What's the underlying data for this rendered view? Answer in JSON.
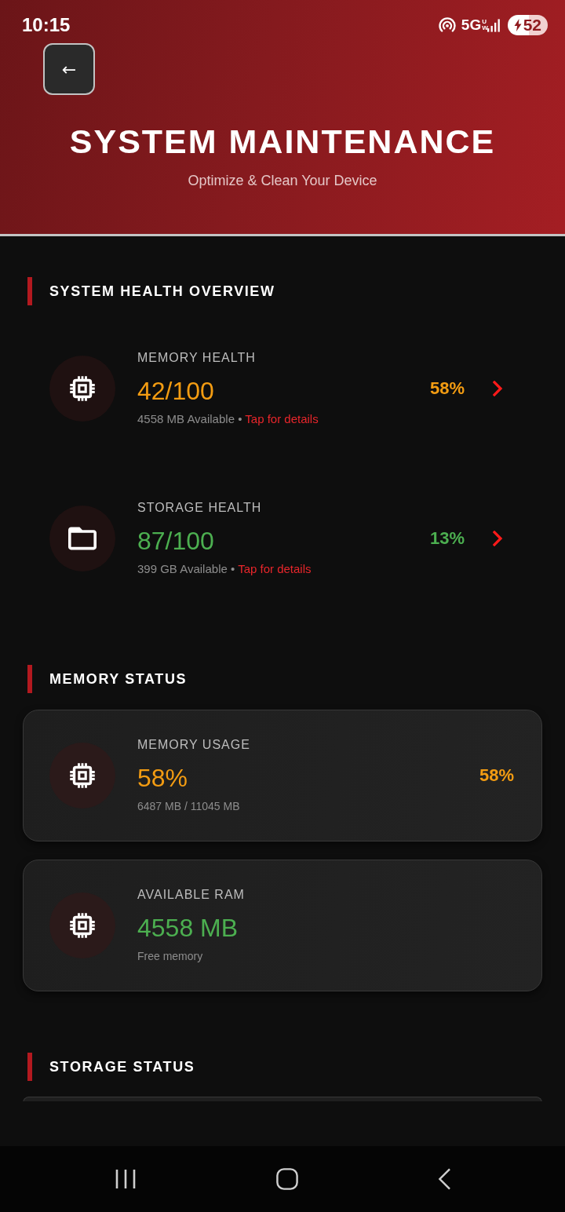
{
  "status_bar": {
    "time": "10:15",
    "network": "5G",
    "network_badge": "UW",
    "battery": "52",
    "charging": true
  },
  "header": {
    "back_label": "←",
    "title": "SYSTEM MAINTENANCE",
    "subtitle": "Optimize & Clean Your Device"
  },
  "health_overview": {
    "heading": "SYSTEM HEALTH OVERVIEW",
    "items": [
      {
        "kind": "memory",
        "label": "MEMORY HEALTH",
        "score": "42/100",
        "available": "4558 MB Available",
        "separator": "•",
        "link": "Tap for details",
        "percent": "58%",
        "color": "#f39c12"
      },
      {
        "kind": "storage",
        "label": "STORAGE HEALTH",
        "score": "87/100",
        "available": "399 GB Available",
        "separator": "•",
        "link": "Tap for details",
        "percent": "13%",
        "color": "#4caf50"
      }
    ]
  },
  "memory_status": {
    "heading": "MEMORY STATUS",
    "cards": [
      {
        "kind": "memory",
        "label": "MEMORY USAGE",
        "value": "58%",
        "detail": "6487 MB / 11045 MB",
        "badge": "58%",
        "color": "#f39c12"
      },
      {
        "kind": "memory",
        "label": "AVAILABLE RAM",
        "value": "4558 MB",
        "detail": "Free memory",
        "color": "#4caf50"
      }
    ]
  },
  "storage_status": {
    "heading": "STORAGE STATUS"
  }
}
